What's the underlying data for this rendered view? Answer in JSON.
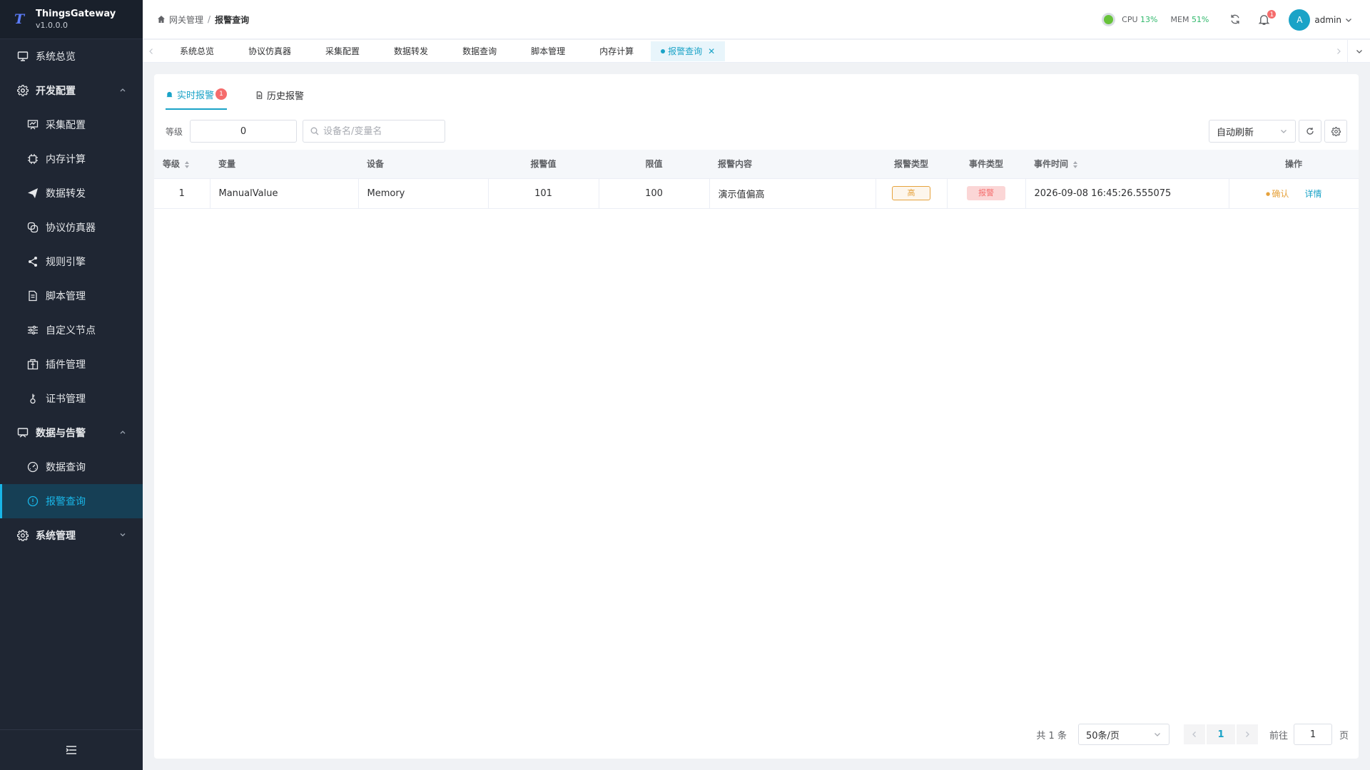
{
  "app": {
    "name": "ThingsGateway",
    "version": "v1.0.0.0"
  },
  "sidebar": {
    "items": [
      {
        "label": "系统总览",
        "icon": "dashboard-icon",
        "type": "top"
      },
      {
        "label": "开发配置",
        "icon": "gear-icon",
        "type": "group",
        "expanded": true
      },
      {
        "label": "采集配置",
        "icon": "chart-board-icon",
        "type": "sub"
      },
      {
        "label": "内存计算",
        "icon": "cpu-icon",
        "type": "sub"
      },
      {
        "label": "数据转发",
        "icon": "send-icon",
        "type": "sub"
      },
      {
        "label": "协议仿真器",
        "icon": "copy-icon",
        "type": "sub"
      },
      {
        "label": "规则引擎",
        "icon": "share-icon",
        "type": "sub"
      },
      {
        "label": "脚本管理",
        "icon": "document-icon",
        "type": "sub"
      },
      {
        "label": "自定义节点",
        "icon": "sliders-icon",
        "type": "sub"
      },
      {
        "label": "插件管理",
        "icon": "package-icon",
        "type": "sub"
      },
      {
        "label": "证书管理",
        "icon": "key-icon",
        "type": "sub"
      },
      {
        "label": "数据与告警",
        "icon": "monitor-icon",
        "type": "group",
        "expanded": true
      },
      {
        "label": "数据查询",
        "icon": "gauge-icon",
        "type": "sub"
      },
      {
        "label": "报警查询",
        "icon": "alert-circle-icon",
        "type": "sub",
        "active": true
      },
      {
        "label": "系统管理",
        "icon": "settings-icon",
        "type": "group",
        "expanded": false
      }
    ]
  },
  "header": {
    "breadcrumb": {
      "root": "网关管理",
      "separator": "/",
      "current": "报警查询"
    },
    "cpu_label": "CPU",
    "cpu_value": "13%",
    "mem_label": "MEM",
    "mem_value": "51%",
    "notifications": "1",
    "avatar_initial": "A",
    "username": "admin"
  },
  "tabs": [
    {
      "label": "系统总览"
    },
    {
      "label": "协议仿真器"
    },
    {
      "label": "采集配置"
    },
    {
      "label": "数据转发"
    },
    {
      "label": "数据查询"
    },
    {
      "label": "脚本管理"
    },
    {
      "label": "内存计算"
    },
    {
      "label": "报警查询",
      "active": true
    }
  ],
  "page": {
    "subtabs": {
      "realtime": "实时报警",
      "realtime_badge": "1",
      "history": "历史报警"
    },
    "filters": {
      "level_label": "等级",
      "level_value": "0",
      "search_placeholder": "设备名/变量名",
      "auto_refresh": "自动刷新"
    },
    "table": {
      "columns": [
        "等级",
        "变量",
        "设备",
        "报警值",
        "限值",
        "报警内容",
        "报警类型",
        "事件类型",
        "事件时间",
        "操作"
      ],
      "rows": [
        {
          "level": "1",
          "variable": "ManualValue",
          "device": "Memory",
          "alarm_value": "101",
          "limit": "100",
          "content": "演示值偏高",
          "alarm_type": "高",
          "event_type": "报警",
          "time": "2026-09-08 16:45:26.555075",
          "op_confirm": "确认",
          "op_detail": "详情"
        }
      ]
    },
    "pagination": {
      "total": "共 1 条",
      "page_size": "50条/页",
      "current": "1",
      "goto_label": "前往",
      "goto_value": "1",
      "page_suffix": "页"
    }
  },
  "colors": {
    "accent": "#1aa3c7",
    "sidebar_bg": "#1f2633",
    "warning": "#e6a23c",
    "danger": "#f56c6c",
    "success": "#2fb86b"
  }
}
